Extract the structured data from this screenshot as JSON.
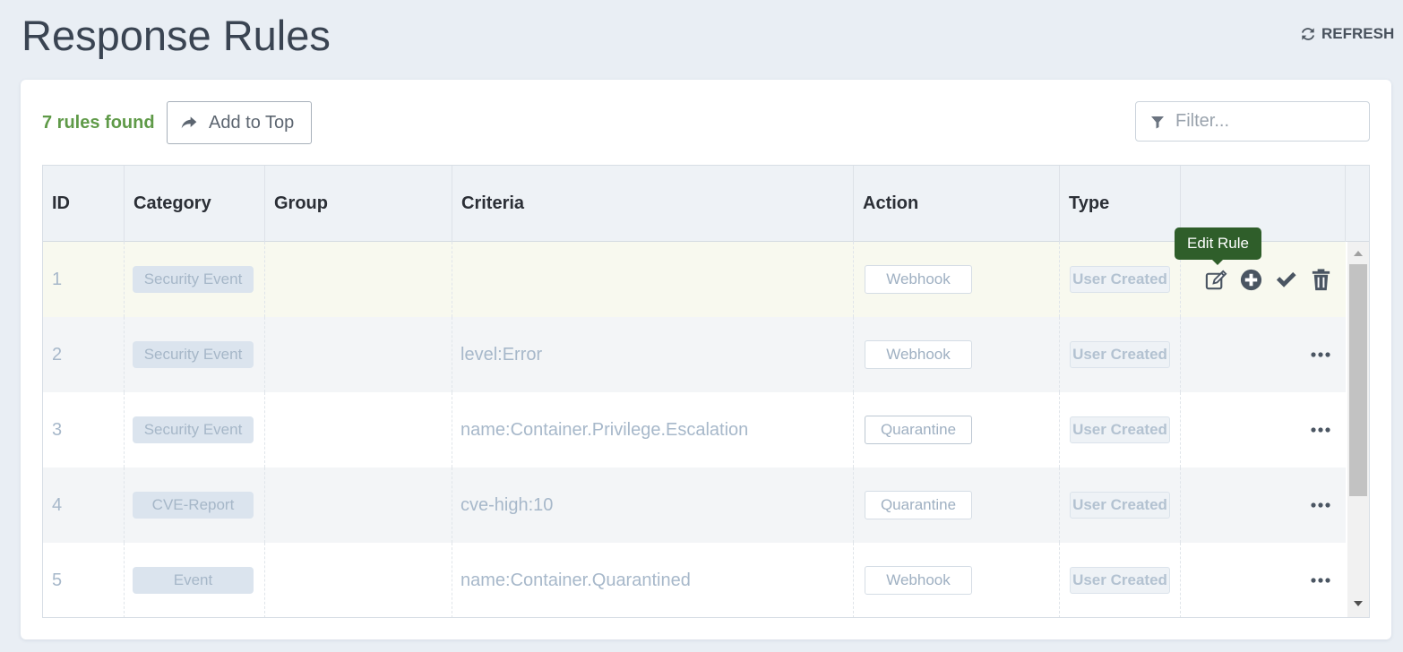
{
  "page": {
    "title": "Response Rules",
    "refresh_label": "REFRESH"
  },
  "toolbar": {
    "rules_count": "7 rules found",
    "add_to_top_label": "Add to Top",
    "filter_placeholder": "Filter..."
  },
  "table": {
    "columns": [
      "ID",
      "Category",
      "Group",
      "Criteria",
      "Action",
      "Type",
      ""
    ],
    "rows": [
      {
        "id": "1",
        "category": "Security Event",
        "group": "",
        "criteria": "",
        "action": "Webhook",
        "type": "User Created"
      },
      {
        "id": "2",
        "category": "Security Event",
        "group": "",
        "criteria": "level:Error",
        "action": "Webhook",
        "type": "User Created"
      },
      {
        "id": "3",
        "category": "Security Event",
        "group": "",
        "criteria": "name:Container.Privilege.Escalation",
        "action": "Quarantine",
        "type": "User Created"
      },
      {
        "id": "4",
        "category": "CVE-Report",
        "group": "",
        "criteria": "cve-high:10",
        "action": "Quarantine",
        "type": "User Created"
      },
      {
        "id": "5",
        "category": "Event",
        "group": "",
        "criteria": "name:Container.Quarantined",
        "action": "Webhook",
        "type": "User Created"
      }
    ],
    "row_actions_icons": [
      "edit-icon",
      "add-circle-icon",
      "check-icon",
      "trash-icon"
    ],
    "more_icon": "ellipsis-icon"
  },
  "tooltip": {
    "text": "Edit Rule"
  },
  "colors": {
    "accent_green": "#5f9a48",
    "tooltip_bg": "#2f5e2a",
    "hover_row_bg": "#f8f9ef",
    "alt_row_bg": "#f3f5f7",
    "icon_color": "#4a5562"
  }
}
